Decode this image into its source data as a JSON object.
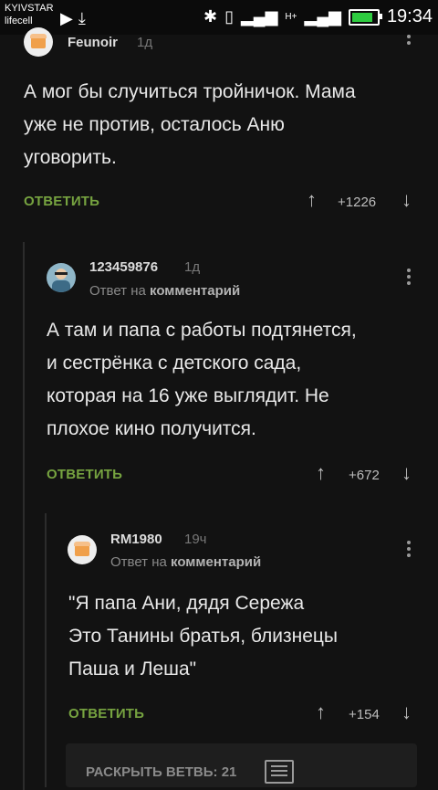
{
  "status_bar": {
    "carrier_1": "KYIVSTAR",
    "carrier_2": "lifecell",
    "network_label": "H+",
    "time": "19:34",
    "battery_level": 0.85
  },
  "comments": [
    {
      "author": "Feunoir",
      "time": "1д",
      "text": "А мог бы случиться тройничок. Мама\nуже не против, осталось Аню\nуговорить.",
      "reply_label": "ОТВЕТИТЬ",
      "rating": "+1226"
    },
    {
      "author": "123459876",
      "time": "1д",
      "reply_to_prefix": "Ответ на",
      "reply_to_link": "комментарий",
      "text": "А там и папа с работы подтянется,\nи сестрёнка с детского сада,\nкоторая на 16 уже выглядит. Не\nплохое кино получится.",
      "reply_label": "ОТВЕТИТЬ",
      "rating": "+672"
    },
    {
      "author": "RM1980",
      "time": "19ч",
      "reply_to_prefix": "Ответ на",
      "reply_to_link": "комментарий",
      "text": "\"Я папа Ани, дядя Сережа\nЭто Танины братья, близнецы\nПаша и Леша\"",
      "reply_label": "ОТВЕТИТЬ",
      "rating": "+154"
    }
  ],
  "expand_thread": {
    "label": "РАСКРЫТЬ ВЕТВЬ: 21"
  },
  "colors": {
    "background": "#121212",
    "accent_green": "#76a340"
  }
}
